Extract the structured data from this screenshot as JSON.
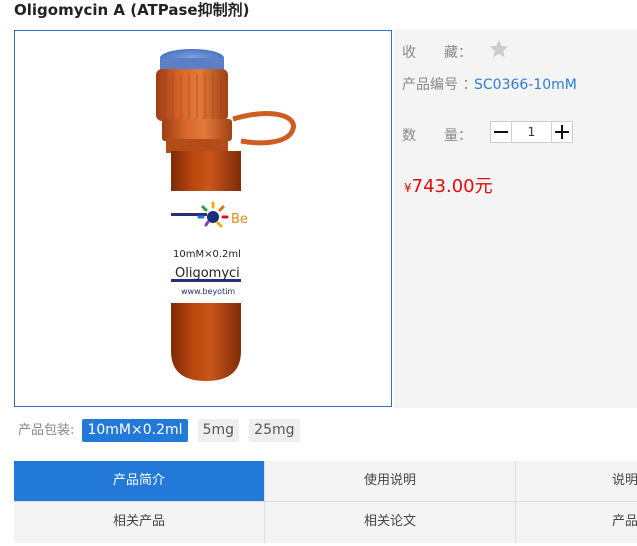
{
  "product": {
    "title": "Oligomycin A (ATPase抑制剂)"
  },
  "image": {
    "label_size": "10mM×0.2ml",
    "label_name": "Oligomyci",
    "label_url": "www.beyotim",
    "brand_fragment": "Be"
  },
  "info": {
    "favorite_label": "收　　藏：",
    "code_label": "产品编号 ：",
    "code_value": "SC0366-10mM",
    "quantity_label": "数　　量：",
    "quantity_value": "1",
    "price_symbol": "¥",
    "price_value": "743.00元"
  },
  "packaging": {
    "label": "产品包装:",
    "options": [
      "10mM×0.2ml",
      "5mg",
      "25mg"
    ],
    "selected": "10mM×0.2ml"
  },
  "tabs": [
    {
      "label": "产品简介",
      "active": true
    },
    {
      "label": "使用说明",
      "active": false
    },
    {
      "label": "说明",
      "active": false
    },
    {
      "label": "相关产品",
      "active": false
    },
    {
      "label": "相关论文",
      "active": false
    },
    {
      "label": "产品",
      "active": false
    }
  ],
  "colors": {
    "accent": "#2279d8",
    "price": "#e4090a",
    "link": "#2d7dd2",
    "cap": "#c2521d",
    "vial": "#a83c0e"
  },
  "icons": {
    "favorite": "star-icon",
    "minus": "minus-icon",
    "plus": "plus-icon"
  }
}
